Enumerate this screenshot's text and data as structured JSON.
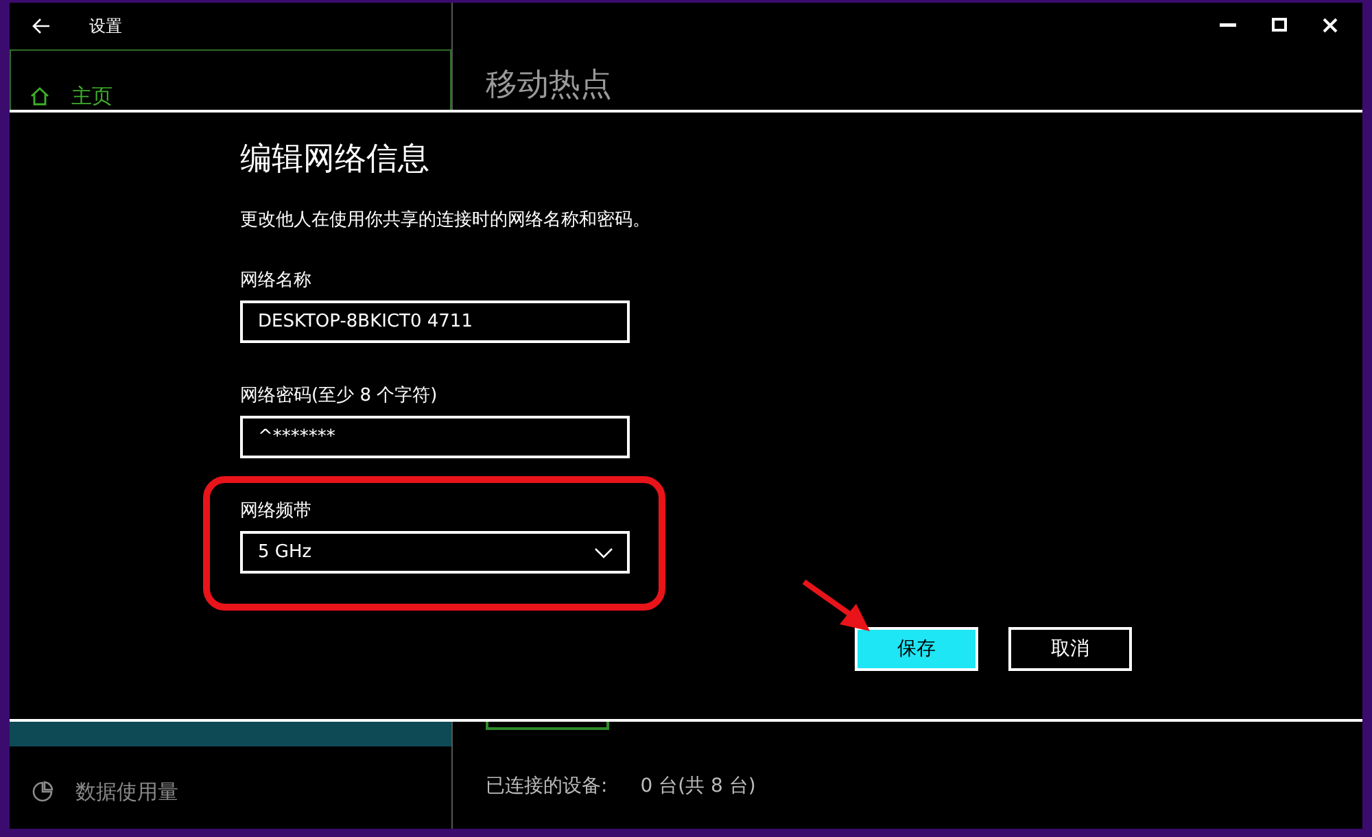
{
  "window": {
    "title": "设置"
  },
  "sidebar": {
    "items": [
      {
        "label": "主页",
        "kind": "home",
        "selected": true
      },
      {
        "label": "数据使用量",
        "kind": "pie",
        "selected": false
      }
    ]
  },
  "page": {
    "title": "移动热点",
    "connected_label": "已连接的设备:",
    "connected_value": "0 台(共 8 台)"
  },
  "dialog": {
    "title": "编辑网络信息",
    "description": "更改他人在使用你共享的连接时的网络名称和密码。",
    "fields": [
      {
        "kind": "text",
        "label": "网络名称",
        "value": "DESKTOP-8BKICT0 4711",
        "highlighted": false
      },
      {
        "kind": "text",
        "label": "网络密码(至少 8 个字符)",
        "value": "^*******",
        "highlighted": false
      },
      {
        "kind": "select",
        "label": "网络频带",
        "value": "5 GHz",
        "highlighted": true
      }
    ],
    "buttons": [
      {
        "label": "保存",
        "primary": true
      },
      {
        "label": "取消",
        "primary": false
      }
    ]
  }
}
